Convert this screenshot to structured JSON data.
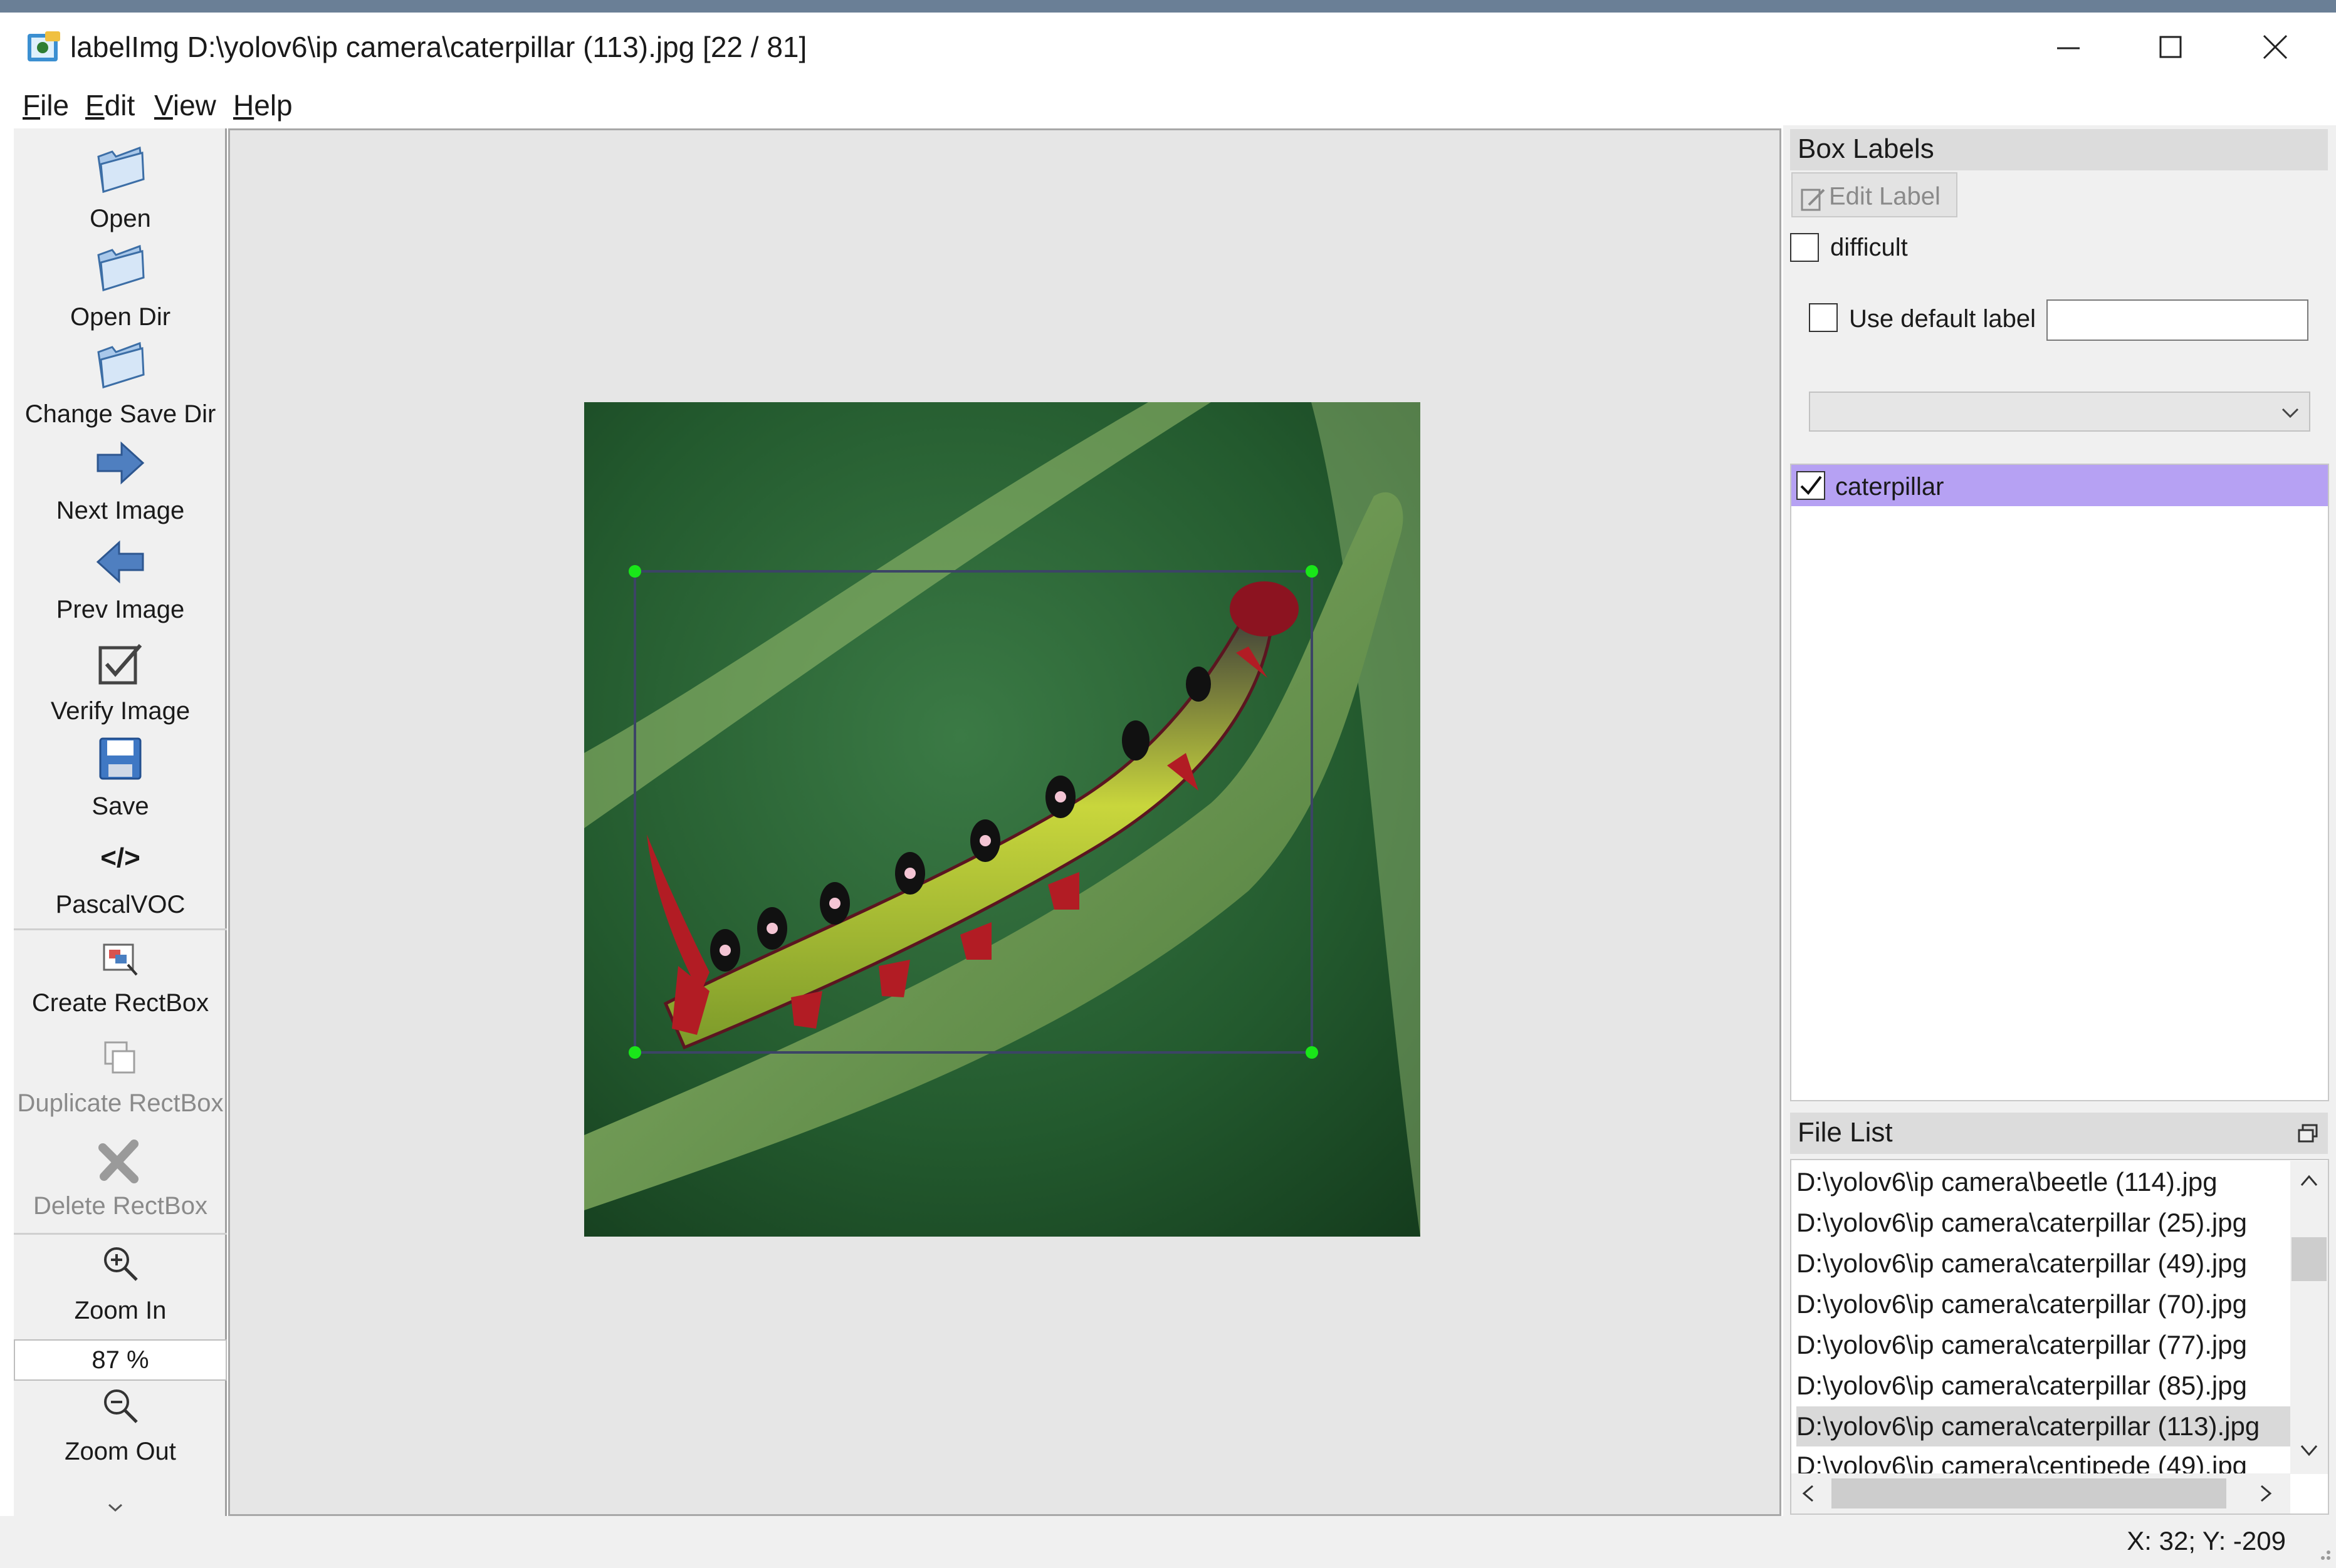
{
  "window": {
    "title": "labelImg D:\\yolov6\\ip camera\\caterpillar (113).jpg [22 / 81]"
  },
  "menu": [
    {
      "label": "File",
      "mnemonic": "F",
      "rest": "ile"
    },
    {
      "label": "Edit",
      "mnemonic": "E",
      "rest": "dit"
    },
    {
      "label": "View",
      "mnemonic": "V",
      "rest": "iew"
    },
    {
      "label": "Help",
      "mnemonic": "H",
      "rest": "elp"
    }
  ],
  "toolbar": {
    "open": "Open",
    "open_dir": "Open Dir",
    "change_save_dir": "Change Save Dir",
    "next_image": "Next Image",
    "prev_image": "Prev Image",
    "verify_image": "Verify Image",
    "save": "Save",
    "format_symbol": "</>",
    "format": "PascalVOC",
    "create_rectbox": "Create RectBox",
    "duplicate_rectbox": "Duplicate RectBox",
    "delete_rectbox": "Delete RectBox",
    "zoom_in": "Zoom In",
    "zoom_value": "87 %",
    "zoom_out": "Zoom Out"
  },
  "box_labels": {
    "title": "Box Labels",
    "edit_label": "Edit Label",
    "difficult": "difficult",
    "use_default_label": "Use default label",
    "default_label_value": "",
    "items": [
      {
        "label": "caterpillar",
        "checked": true
      }
    ]
  },
  "file_list": {
    "title": "File List",
    "files": [
      "D:\\yolov6\\ip camera\\beetle (114).jpg",
      "D:\\yolov6\\ip camera\\caterpillar (25).jpg",
      "D:\\yolov6\\ip camera\\caterpillar (49).jpg",
      "D:\\yolov6\\ip camera\\caterpillar (70).jpg",
      "D:\\yolov6\\ip camera\\caterpillar (77).jpg",
      "D:\\yolov6\\ip camera\\caterpillar (85).jpg",
      "D:\\yolov6\\ip camera\\caterpillar (113).jpg",
      "D:\\yolov6\\ip camera\\centipede (49).jpg"
    ],
    "selected": "D:\\yolov6\\ip camera\\caterpillar (113).jpg"
  },
  "status": {
    "cursor": "X: 32; Y: -209"
  },
  "colors": {
    "selection_highlight": "#b6a1f3",
    "box_handle": "#19e619",
    "box_outline": "#3c4466"
  }
}
